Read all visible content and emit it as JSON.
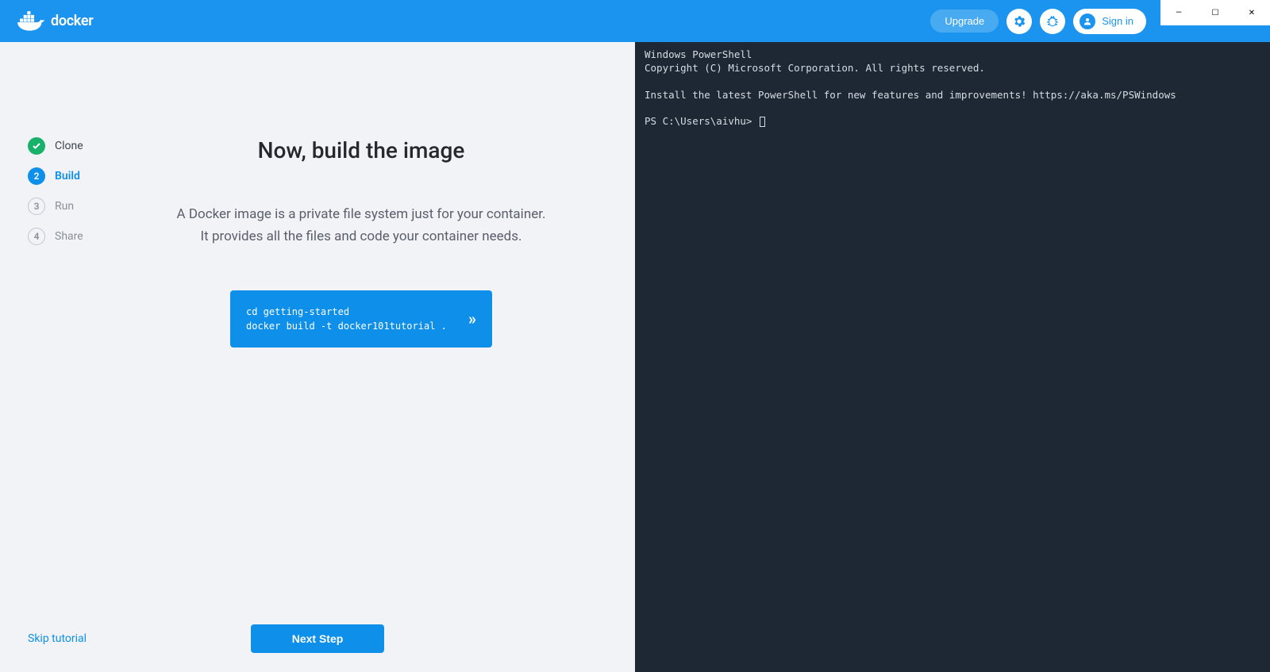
{
  "header": {
    "brand": "docker",
    "upgrade_label": "Upgrade",
    "signin_label": "Sign in"
  },
  "window_controls": {
    "minimize": "—",
    "maximize": "☐",
    "close": "✕"
  },
  "sidebar": {
    "steps": [
      {
        "num": "✓",
        "label": "Clone",
        "state": "done"
      },
      {
        "num": "2",
        "label": "Build",
        "state": "active"
      },
      {
        "num": "3",
        "label": "Run",
        "state": "pending"
      },
      {
        "num": "4",
        "label": "Share",
        "state": "pending"
      }
    ]
  },
  "content": {
    "title": "Now, build the image",
    "description_line1": "A Docker image is a private file system just for your container.",
    "description_line2": "It provides all the files and code your container needs.",
    "code_line1": "cd getting-started",
    "code_line2": "docker build -t docker101tutorial ."
  },
  "footer": {
    "skip_label": "Skip tutorial",
    "next_label": "Next Step"
  },
  "terminal": {
    "line1": "Windows PowerShell",
    "line2": "Copyright (C) Microsoft Corporation. All rights reserved.",
    "line3": "Install the latest PowerShell for new features and improvements! https://aka.ms/PSWindows",
    "prompt": "PS C:\\Users\\aivhu> "
  }
}
